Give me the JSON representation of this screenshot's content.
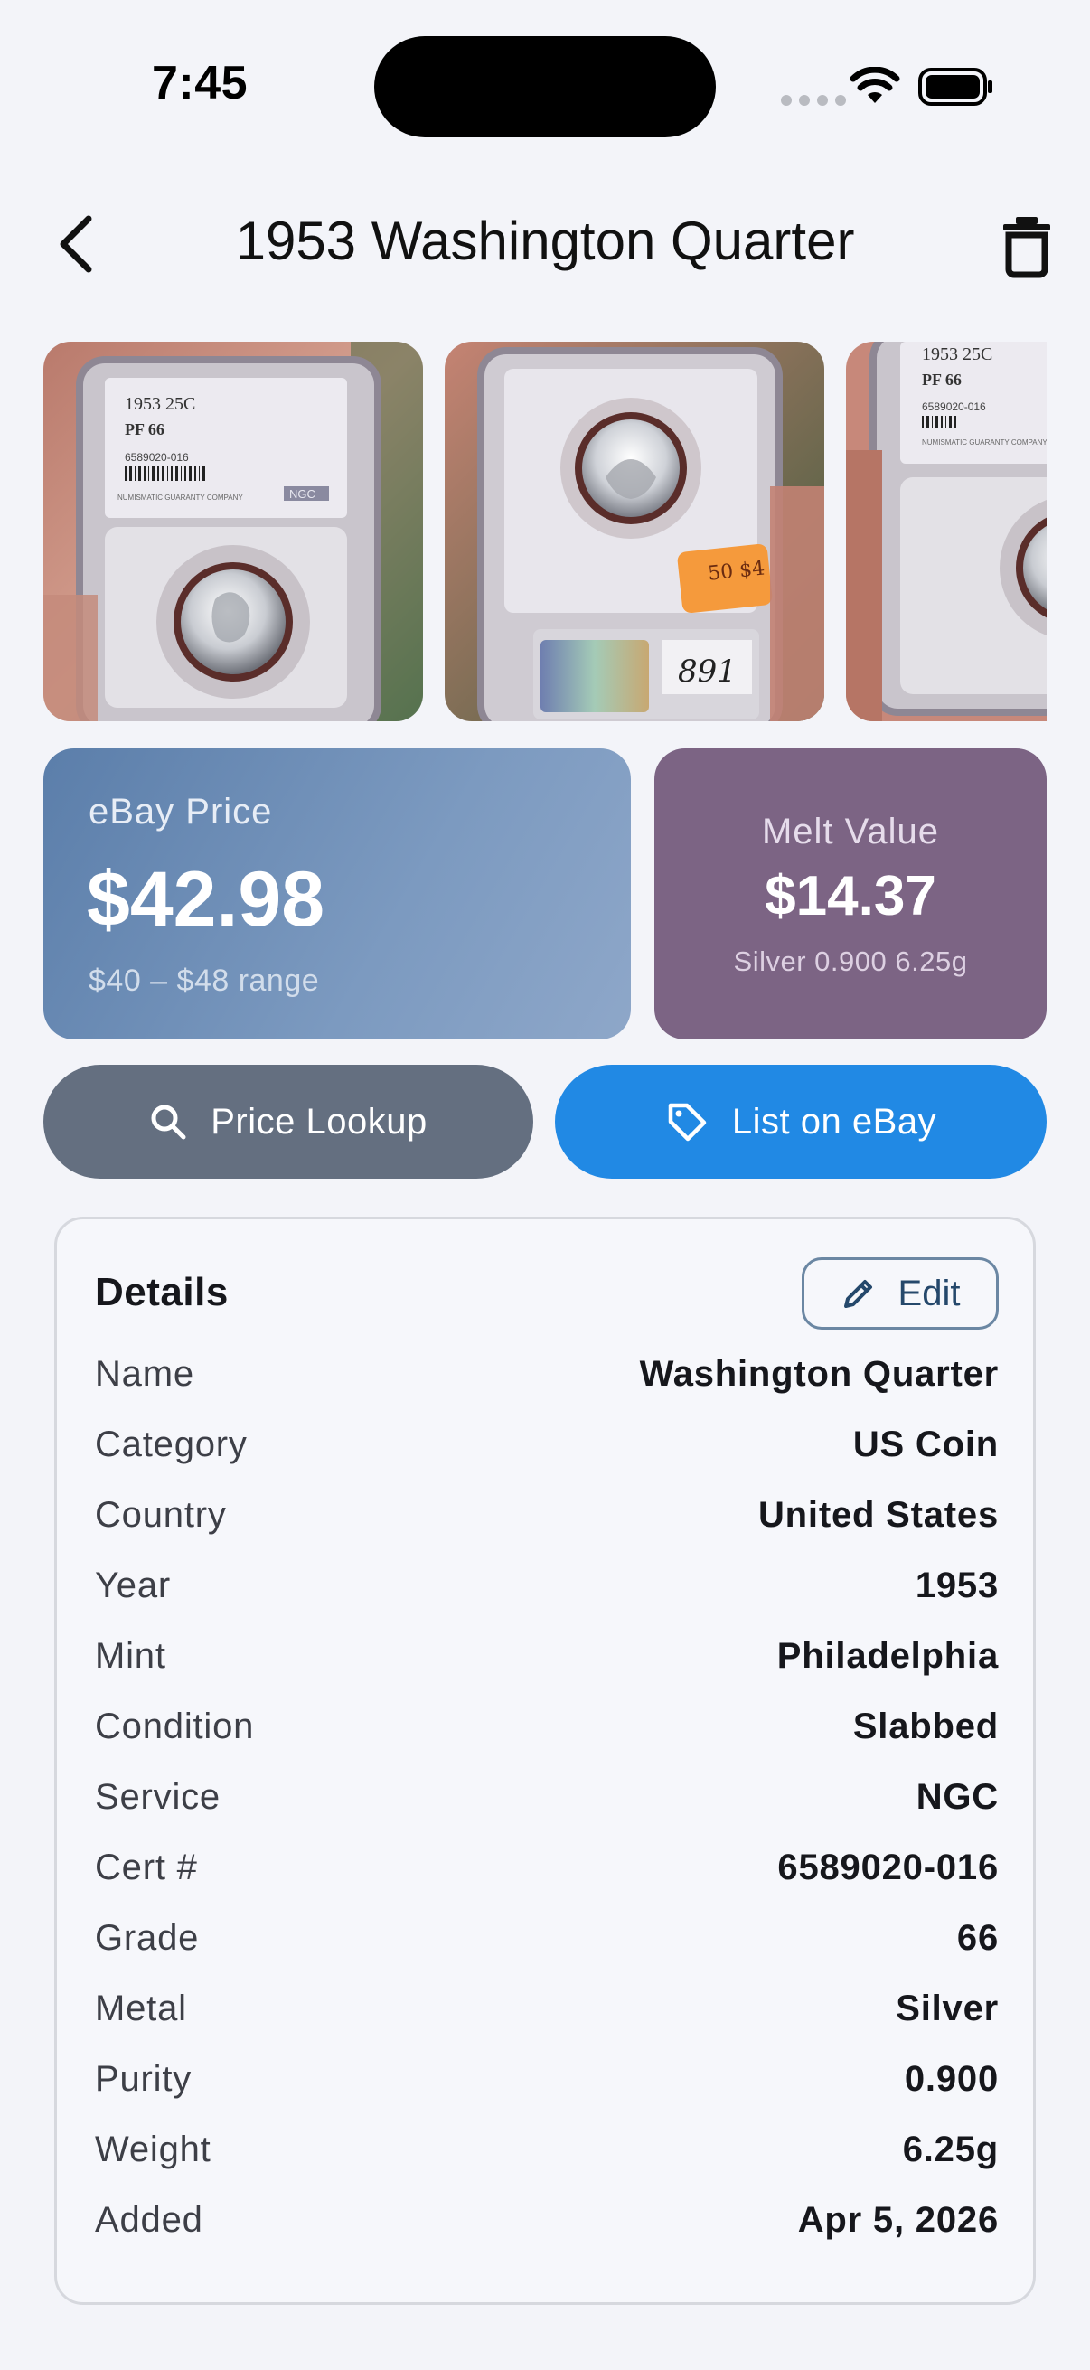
{
  "status_bar": {
    "time": "7:45"
  },
  "nav": {
    "title": "1953 Washington Quarter",
    "back_icon": "chevron-left-icon",
    "delete_icon": "trash-icon"
  },
  "photos": [
    {
      "slab_label": "1953 25C",
      "grade_label": "PF 66",
      "cert": "6589020-016",
      "grader": "NUMISMATIC GUARANTY COMPANY",
      "brand": "NGC"
    },
    {
      "sticker": "50 $4",
      "handwritten": "891"
    },
    {
      "slab_label": "1953 25C",
      "grade_label": "PF 66",
      "cert": "6589020-016",
      "grader": "NUMISMATIC GUARANTY COMPANY"
    }
  ],
  "ebay_card": {
    "label": "eBay Price",
    "price": "$42.98",
    "range": "$40 – $48 range"
  },
  "melt_card": {
    "label": "Melt Value",
    "price": "$14.37",
    "detail": "Silver 0.900 6.25g"
  },
  "actions": {
    "lookup_label": "Price Lookup",
    "ebay_label": "List on eBay"
  },
  "details": {
    "title": "Details",
    "edit_label": "Edit",
    "rows": [
      {
        "label": "Name",
        "value": "Washington Quarter"
      },
      {
        "label": "Category",
        "value": "US Coin"
      },
      {
        "label": "Country",
        "value": "United States"
      },
      {
        "label": "Year",
        "value": "1953"
      },
      {
        "label": "Mint",
        "value": "Philadelphia"
      },
      {
        "label": "Condition",
        "value": "Slabbed"
      },
      {
        "label": "Service",
        "value": "NGC"
      },
      {
        "label": "Cert #",
        "value": "6589020-016"
      },
      {
        "label": "Grade",
        "value": "66"
      },
      {
        "label": "Metal",
        "value": "Silver"
      },
      {
        "label": "Purity",
        "value": "0.900"
      },
      {
        "label": "Weight",
        "value": "6.25g"
      },
      {
        "label": "Added",
        "value": "Apr 5, 2026"
      }
    ]
  },
  "colors": {
    "background": "#f3f4f9",
    "ebay_card": "#6f8fb8",
    "melt_card": "#7c6484",
    "lookup_button": "#646f80",
    "ebay_button": "#2189e4"
  }
}
